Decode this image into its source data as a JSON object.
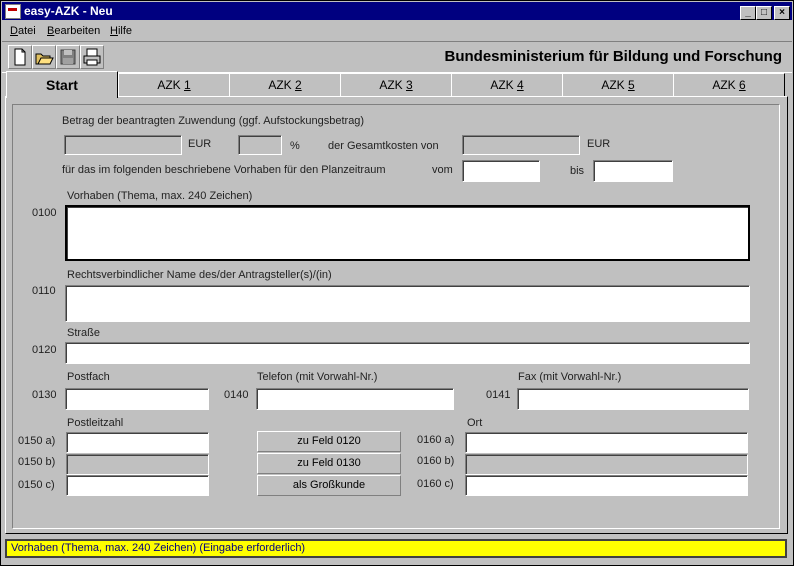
{
  "window": {
    "title": "easy-AZK - Neu"
  },
  "title_buttons": {
    "minimize": "_",
    "maximize": "□",
    "close": "×"
  },
  "menu": [
    {
      "label": "Datei",
      "mnemonic": "D",
      "rest": "atei"
    },
    {
      "label": "Bearbeiten",
      "mnemonic": "B",
      "rest": "earbeiten"
    },
    {
      "label": "Hilfe",
      "mnemonic": "H",
      "rest": "ilfe"
    }
  ],
  "toolbar": {
    "icons": [
      "new-document-icon",
      "open-folder-icon",
      "save-disk-icon",
      "print-icon"
    ],
    "ministry": "Bundesministerium für Bildung und Forschung"
  },
  "tabs": [
    {
      "label": "Start",
      "active": true
    },
    {
      "label": "AZK 1",
      "prefix": "AZK ",
      "num": "1"
    },
    {
      "label": "AZK 2",
      "prefix": "AZK ",
      "num": "2"
    },
    {
      "label": "AZK 3",
      "prefix": "AZK ",
      "num": "3"
    },
    {
      "label": "AZK 4",
      "prefix": "AZK ",
      "num": "4"
    },
    {
      "label": "AZK 5",
      "prefix": "AZK ",
      "num": "5"
    },
    {
      "label": "AZK 6",
      "prefix": "AZK ",
      "num": "6"
    }
  ],
  "form": {
    "betrag_label": "Betrag der beantragten Zuwendung (ggf. Aufstockungsbetrag)",
    "eur": "EUR",
    "percent": "%",
    "gesamtkosten_label": "der Gesamtkosten von",
    "eur2": "EUR",
    "zeitraum_label": "für das im folgenden beschriebene Vorhaben für den Planzeitraum",
    "vom": "vom",
    "bis": "bis",
    "vorhaben": {
      "code": "0100",
      "label": "Vorhaben (Thema, max. 240 Zeichen)",
      "value": ""
    },
    "name": {
      "code": "0110",
      "label": "Rechtsverbindlicher Name des/der Antragsteller(s)/(in)",
      "value": ""
    },
    "strasse": {
      "code": "0120",
      "label": "Straße",
      "value": ""
    },
    "postfach": {
      "code": "0130",
      "label": "Postfach",
      "value": ""
    },
    "telefon": {
      "code": "0140",
      "label": "Telefon (mit Vorwahl-Nr.)",
      "value": ""
    },
    "fax": {
      "code": "0141",
      "label": "Fax (mit Vorwahl-Nr.)",
      "value": ""
    },
    "plz_label": "Postleitzahl",
    "ort_label": "Ort",
    "plz_codes": [
      "0150 a)",
      "0150 b)",
      "0150 c)"
    ],
    "ort_codes": [
      "0160 a)",
      "0160 b)",
      "0160 c)"
    ],
    "mid_buttons": [
      "zu Feld 0120",
      "zu Feld 0130",
      "als Großkunde"
    ]
  },
  "status": {
    "text": "Vorhaben (Thema, max. 240 Zeichen)  (Eingabe erforderlich)"
  }
}
